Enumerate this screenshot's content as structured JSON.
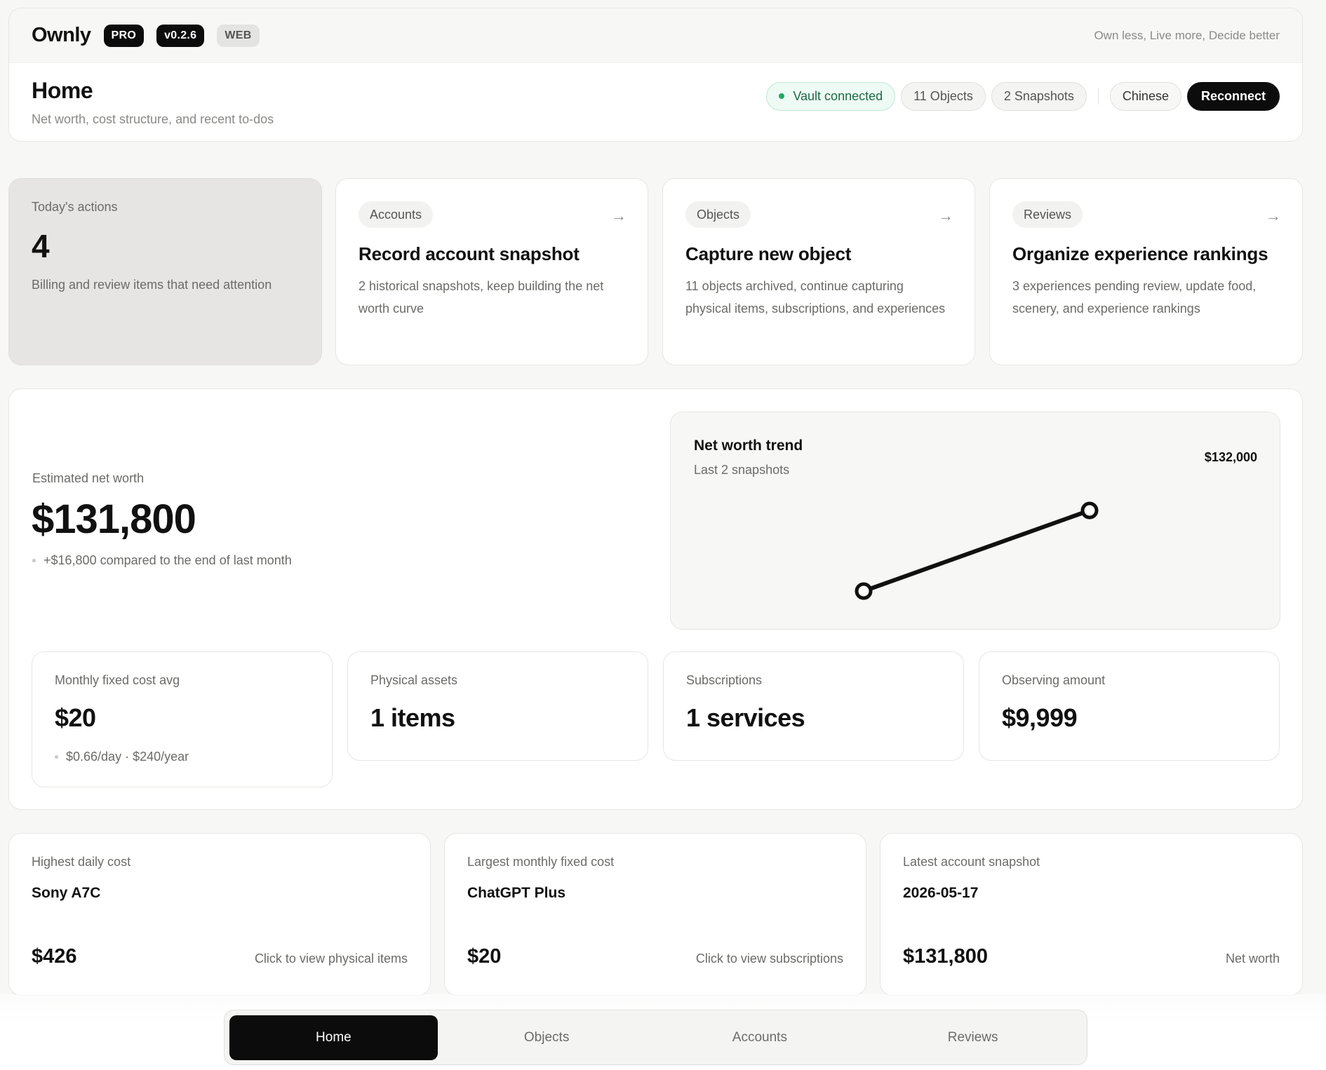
{
  "app": {
    "name": "Ownly",
    "badges": [
      "PRO",
      "v0.2.6",
      "WEB"
    ],
    "tagline": "Own less, Live more, Decide better"
  },
  "page": {
    "title": "Home",
    "subtitle": "Net worth, cost structure, and recent to-dos"
  },
  "status": {
    "vault": "Vault connected",
    "objects": "11 Objects",
    "snapshots": "2 Snapshots",
    "language": "Chinese",
    "reconnect": "Reconnect"
  },
  "today": {
    "label": "Today's actions",
    "count": "4",
    "description": "Billing and review items that need attention"
  },
  "actions": [
    {
      "tag": "Accounts",
      "title": "Record account snapshot",
      "description": "2 historical snapshots, keep building the net worth curve"
    },
    {
      "tag": "Objects",
      "title": "Capture new object",
      "description": "11 objects archived, continue capturing physical items, subscriptions, and experiences"
    },
    {
      "tag": "Reviews",
      "title": "Organize experience rankings",
      "description": "3 experiences pending review, update food, scenery, and experience rankings"
    }
  ],
  "net_worth": {
    "label": "Estimated net worth",
    "value": "$131,800",
    "delta": "+$16,800 compared to the end of last month"
  },
  "trend": {
    "title": "Net worth trend",
    "subtitle": "Last 2 snapshots",
    "max_label": "$132,000",
    "points": [
      115000,
      131800
    ]
  },
  "stats": [
    {
      "label": "Monthly fixed cost avg",
      "value": "$20",
      "note": "$0.66/day · $240/year"
    },
    {
      "label": "Physical assets",
      "value": "1 items"
    },
    {
      "label": "Subscriptions",
      "value": "1 services"
    },
    {
      "label": "Observing amount",
      "value": "$9,999"
    }
  ],
  "highlights": [
    {
      "label": "Highest daily cost",
      "title": "Sony A7C",
      "amount": "$426",
      "link": "Click to view physical items"
    },
    {
      "label": "Largest monthly fixed cost",
      "title": "ChatGPT Plus",
      "amount": "$20",
      "link": "Click to view subscriptions"
    },
    {
      "label": "Latest account snapshot",
      "title": "2026-05-17",
      "amount": "$131,800",
      "link": "Net worth"
    }
  ],
  "nav": {
    "items": [
      "Home",
      "Objects",
      "Accounts",
      "Reviews"
    ],
    "active": "Home"
  },
  "arrow_glyph": "→",
  "colors": {
    "accent_dark": "#0c0c0c",
    "connected_green": "#22a867",
    "today_card_bg": "#e6e5e3"
  }
}
